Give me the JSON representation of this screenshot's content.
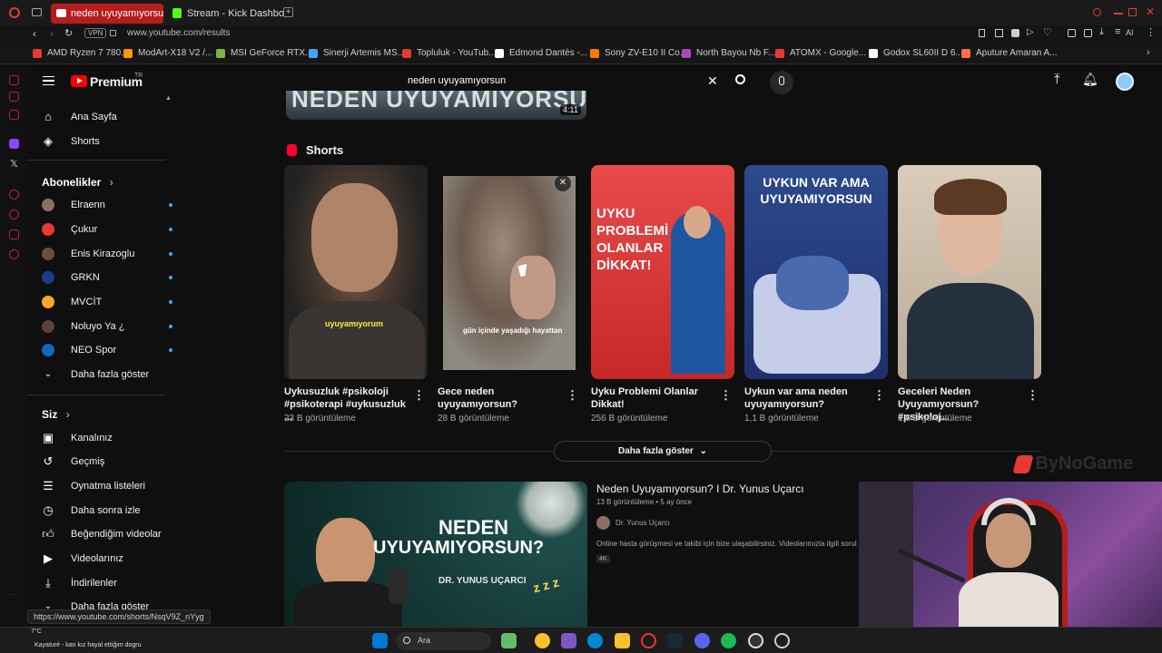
{
  "browser": {
    "tabs": [
      {
        "label": "neden uyuyamıyorsun - Yo"
      },
      {
        "label": "Stream - Kick Dashboard"
      }
    ],
    "url": "www.youtube.com/results",
    "vpn": "VPN",
    "ai_label": "AI",
    "bookmarks": [
      "AMD Ryzen 7 780...",
      "ModArt-X18 V2 /...",
      "MSI GeForce RTX...",
      "Sinerji Artemis MS...",
      "Topluluk - YouTub...",
      "Edmond Dantès -...",
      "Sony ZV-E10 II Co...",
      "North Bayou Nb F...",
      "ATOMX - Google...",
      "Godox SL60II D 6...",
      "Aputure Amaran A..."
    ]
  },
  "youtube": {
    "logo": "Premium",
    "logo_sup": "TR",
    "search": {
      "value": "neden uyuyamıyorsun"
    }
  },
  "sidebar": {
    "main": [
      {
        "label": "Ana Sayfa",
        "icon": "home-icon"
      },
      {
        "label": "Shorts",
        "icon": "shorts-icon"
      }
    ],
    "subs_header": "Abonelikler",
    "subs": [
      {
        "label": "Elraenn",
        "color": "#8d6e63"
      },
      {
        "label": "Çukur",
        "color": "#e53935"
      },
      {
        "label": "Enis Kirazoglu",
        "color": "#6d4c41"
      },
      {
        "label": "GRKN",
        "color": "#1e3a8a"
      },
      {
        "label": "MVCİT",
        "color": "#f9a825"
      },
      {
        "label": "Noluyo Ya ¿",
        "color": "#5d4037"
      },
      {
        "label": "NEO Spor",
        "color": "#1565c0"
      }
    ],
    "more1": "Daha fazla göster",
    "you_header": "Siz",
    "you": [
      {
        "label": "Kanalınız",
        "icon": "channel-icon"
      },
      {
        "label": "Geçmiş",
        "icon": "history-icon"
      },
      {
        "label": "Oynatma listeleri",
        "icon": "playlists-icon"
      },
      {
        "label": "Daha sonra izle",
        "icon": "watch-later-icon"
      },
      {
        "label": "Beğendiğim videolar",
        "icon": "liked-icon"
      },
      {
        "label": "Videolarınız",
        "icon": "your-videos-icon"
      },
      {
        "label": "İndirilenler",
        "icon": "downloads-icon"
      }
    ],
    "more2": "Daha fazla göster"
  },
  "top_video": {
    "title_partial": "NEDEN UYUYAMIYORSUN",
    "duration": "4:11"
  },
  "shorts": {
    "header": "Shorts",
    "items": [
      {
        "title": "Uykusuzluk #psikoloji #psikoterapi #uykusuzluk ...",
        "views": "23 B görüntüleme",
        "caption": "uyuyamıyorum"
      },
      {
        "title": "Gece neden uyuyamıyorsun?",
        "views": "28 B görüntüleme",
        "caption": "gün içinde yaşadığı hayattan"
      },
      {
        "title": "Uyku Problemi Olanlar Dikkat!",
        "views": "256 B görüntüleme",
        "caption": "UYKU PROBLEMİ OLANLAR DİKKAT!"
      },
      {
        "title": "Uykun var ama neden uyuyamıyorsun?",
        "views": "1,1 B görüntüleme",
        "caption": "UYKUN VAR AMA UYUYAMIYORSUN"
      },
      {
        "title": "Geceleri Neden Uyuyamıyorsun? #psikoloj...",
        "views": "1,6 B görüntüleme",
        "caption": ""
      }
    ],
    "more": "Daha fazla göster"
  },
  "video": {
    "title": "Neden Uyuyamıyorsun? I Dr. Yunus Uçarcı",
    "meta": "13 B görüntüleme • 5 ay önce",
    "channel": "Dr. Yunus Uçarcı",
    "desc": "Online hasta görüşmesi ve takibi için bize ulaşabilirsiniz. Videolarımızla ilgili sorul",
    "badge": "4K",
    "thumb_line1": "NEDEN",
    "thumb_line2": "UYUYAMIYORSUN?",
    "thumb_sub": "DR. YUNUS UÇARCI",
    "thumb_z": "z z z"
  },
  "overlay": {
    "watermark": "ByNoGame"
  },
  "status_url": "https://www.youtube.com/shorts/NsqV9Z_nYyg",
  "taskbar": {
    "weather": "7°C",
    "song": "Kayaturé - kan kız hayal ettiğim dogru",
    "search": "Ara"
  }
}
